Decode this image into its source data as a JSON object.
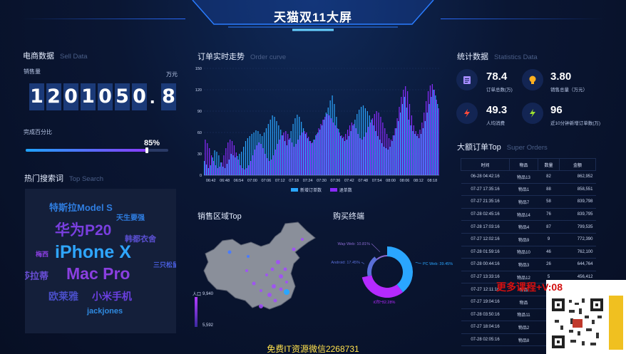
{
  "header": {
    "title": "天猫双11大屏"
  },
  "sell": {
    "title": "电商数据",
    "title_en": "Sell Data",
    "sales_label": "销售量",
    "unit": "万元",
    "digits": [
      "1",
      "2",
      "0",
      "1",
      "0",
      "5",
      "0",
      ".",
      "8"
    ],
    "progress_label": "完成百分比",
    "progress_value_text": "85%",
    "progress": 0.85
  },
  "hot": {
    "title": "热门搜索词",
    "title_en": "Top Search",
    "words": [
      {
        "text": "特斯拉Model S",
        "color": "#2f7de0"
      },
      {
        "text": "天生要强",
        "color": "#2f7de0"
      },
      {
        "text": "华为P20",
        "color": "#7a3fe0"
      },
      {
        "text": "韩都衣舍",
        "color": "#5a4fd0"
      },
      {
        "text": "iPhone X",
        "color": "#2fa6ff"
      },
      {
        "text": "梅西",
        "color": "#8a3fe0"
      },
      {
        "text": "莎拉蒂",
        "color": "#6a4fd8"
      },
      {
        "text": "Mac Pro",
        "color": "#8a3fe0"
      },
      {
        "text": "三只松鼠",
        "color": "#4a5fe0"
      },
      {
        "text": "欧莱雅",
        "color": "#4a4fc8"
      },
      {
        "text": "小米手机",
        "color": "#6a3fe0"
      },
      {
        "text": "jackjones",
        "color": "#2f8ae0"
      }
    ]
  },
  "order": {
    "title": "订单实时走势",
    "title_en": "Order curve",
    "legend": [
      "新增订单数",
      "退单数"
    ],
    "chart_data": {
      "type": "bar",
      "y_ticks": [
        "150",
        "120",
        "90",
        "60",
        "30",
        "0"
      ],
      "x_ticks": [
        "06:42",
        "06:48",
        "06:54",
        "07:00",
        "07:06",
        "07:12",
        "07:18",
        "07:24",
        "07:30",
        "07:36",
        "07:42",
        "07:48",
        "07:54",
        "08:00",
        "08:06",
        "08:12",
        "08:18"
      ],
      "ylim": [
        0,
        150
      ],
      "series": [
        {
          "name": "新增订单数",
          "color": "#2aa6ff",
          "values": [
            20,
            15,
            10,
            14,
            25,
            35,
            33,
            28,
            18,
            12,
            10,
            16,
            22,
            30,
            28,
            25,
            27,
            30,
            33,
            40,
            48,
            52,
            55,
            58,
            60,
            63,
            62,
            58,
            55,
            60,
            66,
            72,
            78,
            84,
            82,
            76,
            70,
            64,
            56,
            48,
            42,
            50,
            62,
            72,
            80,
            85,
            82,
            75,
            66,
            58,
            52,
            48,
            45,
            50,
            56,
            60,
            64,
            70,
            78,
            88,
            95,
            105,
            112,
            100,
            82,
            65,
            55,
            52,
            48,
            50,
            55,
            62,
            70,
            78,
            86,
            92,
            96,
            98,
            94,
            90,
            84,
            78,
            70,
            62,
            55,
            50,
            45,
            40,
            38,
            36,
            40,
            48,
            56,
            66,
            76,
            88,
            100,
            110,
            95,
            78,
            70,
            62,
            58,
            55,
            52,
            58,
            66,
            76,
            88,
            100,
            110,
            120,
            112,
            100
          ]
        },
        {
          "name": "退单数",
          "color": "#8a2aff",
          "values": [
            50,
            45,
            38,
            28,
            20,
            14,
            10,
            12,
            18,
            28,
            38,
            46,
            50,
            48,
            42,
            32,
            22,
            14,
            10,
            8,
            10,
            14,
            20,
            28,
            36,
            42,
            46,
            44,
            38,
            30,
            24,
            20,
            22,
            28,
            36,
            44,
            50,
            56,
            60,
            62,
            58,
            52,
            46,
            40,
            44,
            50,
            56,
            60,
            62,
            60,
            54,
            48,
            46,
            50,
            58,
            66,
            72,
            78,
            82,
            86,
            84,
            80,
            74,
            70,
            66,
            60,
            56,
            54,
            58,
            64,
            70,
            74,
            72,
            66,
            58,
            52,
            50,
            54,
            60,
            68,
            74,
            80,
            86,
            90,
            88,
            82,
            74,
            66,
            58,
            52,
            50,
            56,
            66,
            80,
            96,
            110,
            120,
            125,
            118,
            100,
            84,
            70,
            62,
            58,
            64,
            74,
            88,
            104,
            118,
            126,
            128,
            120,
            106,
            94
          ]
        }
      ]
    }
  },
  "region": {
    "title": "销售区域Top",
    "max": "9,940",
    "min": "5,592",
    "label": "人口"
  },
  "terminal": {
    "title": "购买终端",
    "chart_data": {
      "type": "pie",
      "slices": [
        {
          "name": "PC Web",
          "value": 39.45,
          "label": "PC Web: 39.45%",
          "color": "#2aa6ff"
        },
        {
          "name": "iOS",
          "value": 32.28,
          "label": "iOS: 32.28%",
          "color": "#b42aff"
        },
        {
          "name": "Android",
          "value": 17.45,
          "label": "Android: 17.45%",
          "color": "#5a6fd8"
        },
        {
          "name": "Wap Web",
          "value": 10.81,
          "label": "Wap Web: 10.81%",
          "color": "#8a6ad0"
        }
      ]
    }
  },
  "stats": {
    "title": "统计数据",
    "title_en": "Statistics Data",
    "items": [
      {
        "value": "78.4",
        "label": "订单总数(万)",
        "icon": "clipboard-icon",
        "color": "#a58cff"
      },
      {
        "value": "3.80",
        "label": "销售总量（万元）",
        "icon": "lightbulb-icon",
        "color": "#ffb020"
      },
      {
        "value": "49.3",
        "label": "人均消费",
        "icon": "lightning-icon",
        "color": "#ff4a3a"
      },
      {
        "value": "96",
        "label": "近10分钟新增订单数(万)",
        "icon": "lightning-icon",
        "color": "#9ce030"
      }
    ]
  },
  "orders": {
    "title": "大额订单Top",
    "title_en": "Super Orders",
    "columns": [
      "时间",
      "物品",
      "数量",
      "金额"
    ],
    "rows": [
      [
        "06-28 04:42:16",
        "物品13",
        "82",
        "862,952"
      ],
      [
        "07-27 17:35:16",
        "物品1",
        "88",
        "858,551"
      ],
      [
        "07-27 21:35:16",
        "物品7",
        "58",
        "839,798"
      ],
      [
        "07-28 02:45:16",
        "物品14",
        "76",
        "839,795"
      ],
      [
        "07-28 17:03:16",
        "物品4",
        "87",
        "799,535"
      ],
      [
        "07-27 12:02:16",
        "物品9",
        "9",
        "772,390"
      ],
      [
        "07-28 01:59:16",
        "物品10",
        "46",
        "762,100"
      ],
      [
        "07-28 00:44:16",
        "物品3",
        "26",
        "644,764"
      ],
      [
        "07-27 13:33:16",
        "物品12",
        "5",
        "456,412"
      ],
      [
        "07-27 12:11:16",
        "物品",
        "",
        ""
      ],
      [
        "07-27 19:04:16",
        "物品",
        "",
        ""
      ],
      [
        "07-28 03:50:16",
        "物品11",
        "",
        ""
      ],
      [
        "07-27 18:04:16",
        "物品2",
        "",
        ""
      ],
      [
        "07-28 02:05:16",
        "物品8",
        "",
        ""
      ]
    ]
  },
  "footer": {
    "text": "免费IT资源微信2268731"
  },
  "watermark": {
    "text": "更多课程+V:08"
  }
}
